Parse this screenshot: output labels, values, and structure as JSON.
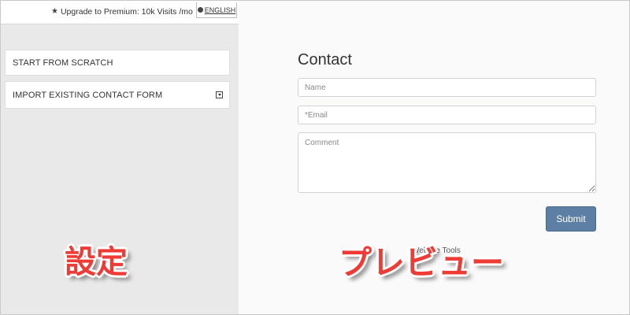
{
  "topbar": {
    "upgrade_text": "Upgrade to Premium: 10k Visits /mo",
    "language_label": "ENGLISH"
  },
  "settings": {
    "options": [
      {
        "label": "START FROM SCRATCH"
      },
      {
        "label": "IMPORT EXISTING CONTACT FORM"
      }
    ]
  },
  "preview": {
    "title": "Contact",
    "fields": {
      "name_placeholder": "Name",
      "email_placeholder": "*Email",
      "comment_placeholder": "Comment"
    },
    "submit_label": "Submit",
    "credit_text": "Website Tools"
  },
  "annotations": {
    "settings_label": "設定",
    "preview_label": "プレビュー"
  },
  "colors": {
    "annotation": "#ee3b36",
    "submit_bg": "#5d7fa3",
    "left_panel_bg": "#e9e9e9"
  }
}
